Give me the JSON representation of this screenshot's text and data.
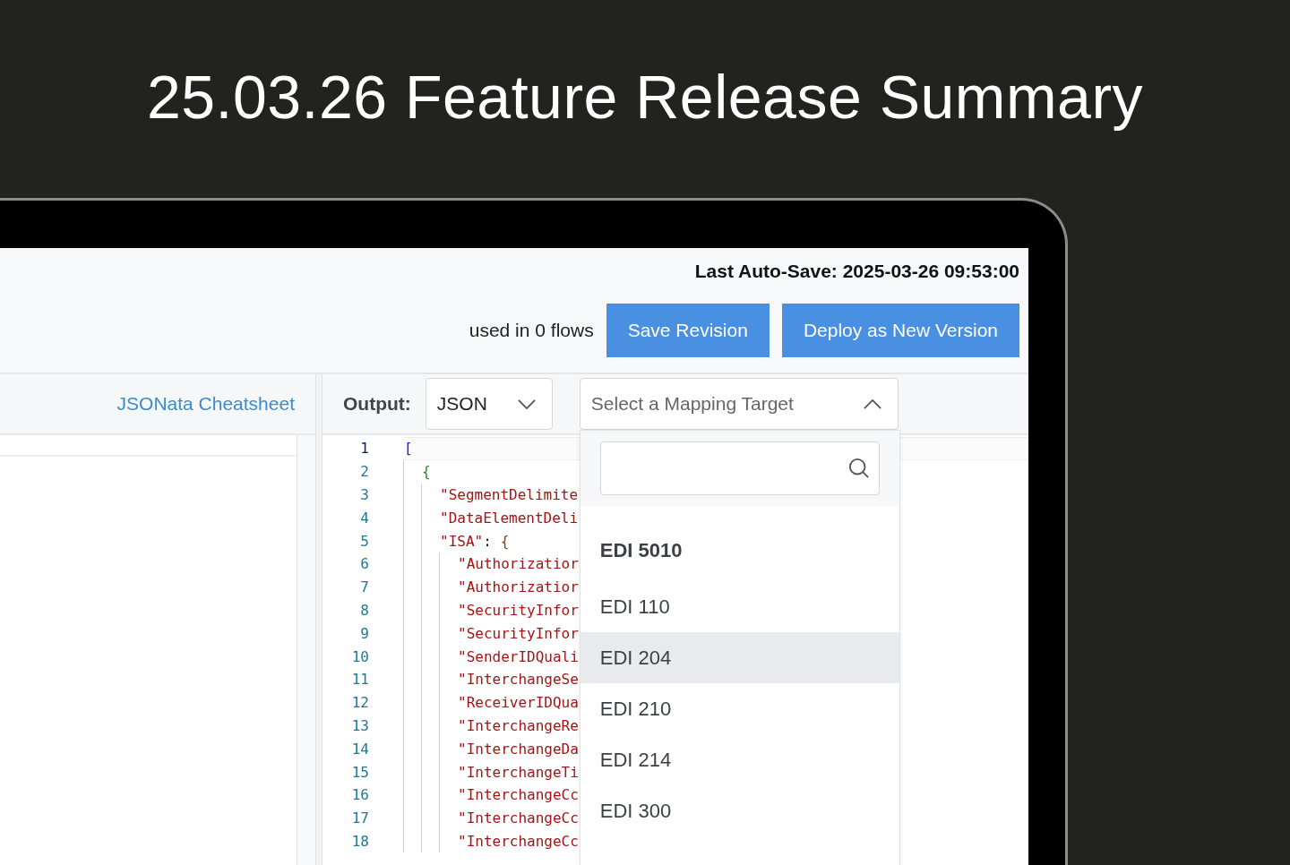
{
  "headline": "25.03.26 Feature Release Summary",
  "header": {
    "auto_save": "Last Auto-Save: 2025-03-26 09:53:00",
    "usage": "used in 0 flows",
    "buttons": [
      "Save Revision",
      "Deploy as New Version"
    ]
  },
  "left_panel": {
    "link": "JSONata Cheatsheet"
  },
  "output_panel": {
    "label": "Output:",
    "format_select": {
      "value": "JSON",
      "expanded": false
    },
    "target_select": {
      "placeholder": "Select a Mapping Target",
      "expanded": true,
      "groups": [
        {
          "label": "EDI 5010",
          "options": [
            {
              "label": "EDI 110",
              "highlighted": false
            },
            {
              "label": "EDI 204",
              "highlighted": true
            },
            {
              "label": "EDI 210",
              "highlighted": false
            },
            {
              "label": "EDI 214",
              "highlighted": false
            },
            {
              "label": "EDI 300",
              "highlighted": false
            }
          ]
        }
      ]
    },
    "editor": {
      "lines": [
        {
          "number": "1",
          "active": true,
          "tokens": [
            {
              "kind": "bracket",
              "text": "["
            }
          ],
          "children": [
            {
              "number": "2",
              "active": false,
              "tokens": [
                {
                  "kind": "brace",
                  "text": "{"
                }
              ],
              "children": [
                {
                  "number": "3",
                  "active": false,
                  "tokens": [
                    {
                      "kind": "key",
                      "text": "\"SegmentDelimite"
                    }
                  ]
                },
                {
                  "number": "4",
                  "active": false,
                  "tokens": [
                    {
                      "kind": "key",
                      "text": "\"DataElementDeli"
                    }
                  ]
                },
                {
                  "number": "5",
                  "active": false,
                  "tokens": [
                    {
                      "kind": "key",
                      "text": "\"ISA\""
                    },
                    {
                      "kind": "punct",
                      "text": ":"
                    },
                    {
                      "kind": "object",
                      "text": "{"
                    }
                  ],
                  "children": [
                    {
                      "number": "6",
                      "active": false,
                      "tokens": [
                        {
                          "kind": "key",
                          "text": "\"Authorizatior"
                        }
                      ]
                    },
                    {
                      "number": "7",
                      "active": false,
                      "tokens": [
                        {
                          "kind": "key",
                          "text": "\"Authorizatior"
                        }
                      ]
                    },
                    {
                      "number": "8",
                      "active": false,
                      "tokens": [
                        {
                          "kind": "key",
                          "text": "\"SecurityInfor"
                        }
                      ]
                    },
                    {
                      "number": "9",
                      "active": false,
                      "tokens": [
                        {
                          "kind": "key",
                          "text": "\"SecurityInfor"
                        }
                      ]
                    },
                    {
                      "number": "10",
                      "active": false,
                      "tokens": [
                        {
                          "kind": "key",
                          "text": "\"SenderIDQuali"
                        }
                      ]
                    },
                    {
                      "number": "11",
                      "active": false,
                      "tokens": [
                        {
                          "kind": "key",
                          "text": "\"InterchangeSe"
                        }
                      ]
                    },
                    {
                      "number": "12",
                      "active": false,
                      "tokens": [
                        {
                          "kind": "key",
                          "text": "\"ReceiverIDQua"
                        }
                      ]
                    },
                    {
                      "number": "13",
                      "active": false,
                      "tokens": [
                        {
                          "kind": "key",
                          "text": "\"InterchangeRe"
                        }
                      ]
                    },
                    {
                      "number": "14",
                      "active": false,
                      "tokens": [
                        {
                          "kind": "key",
                          "text": "\"InterchangeDa"
                        }
                      ]
                    },
                    {
                      "number": "15",
                      "active": false,
                      "tokens": [
                        {
                          "kind": "key",
                          "text": "\"InterchangeTi"
                        }
                      ]
                    },
                    {
                      "number": "16",
                      "active": false,
                      "tokens": [
                        {
                          "kind": "key",
                          "text": "\"InterchangeCc"
                        }
                      ]
                    },
                    {
                      "number": "17",
                      "active": false,
                      "tokens": [
                        {
                          "kind": "key",
                          "text": "\"InterchangeCc"
                        }
                      ]
                    },
                    {
                      "number": "18",
                      "active": false,
                      "tokens": [
                        {
                          "kind": "key",
                          "text": "\"InterchangeCc"
                        }
                      ]
                    }
                  ]
                }
              ]
            }
          ]
        }
      ]
    }
  }
}
